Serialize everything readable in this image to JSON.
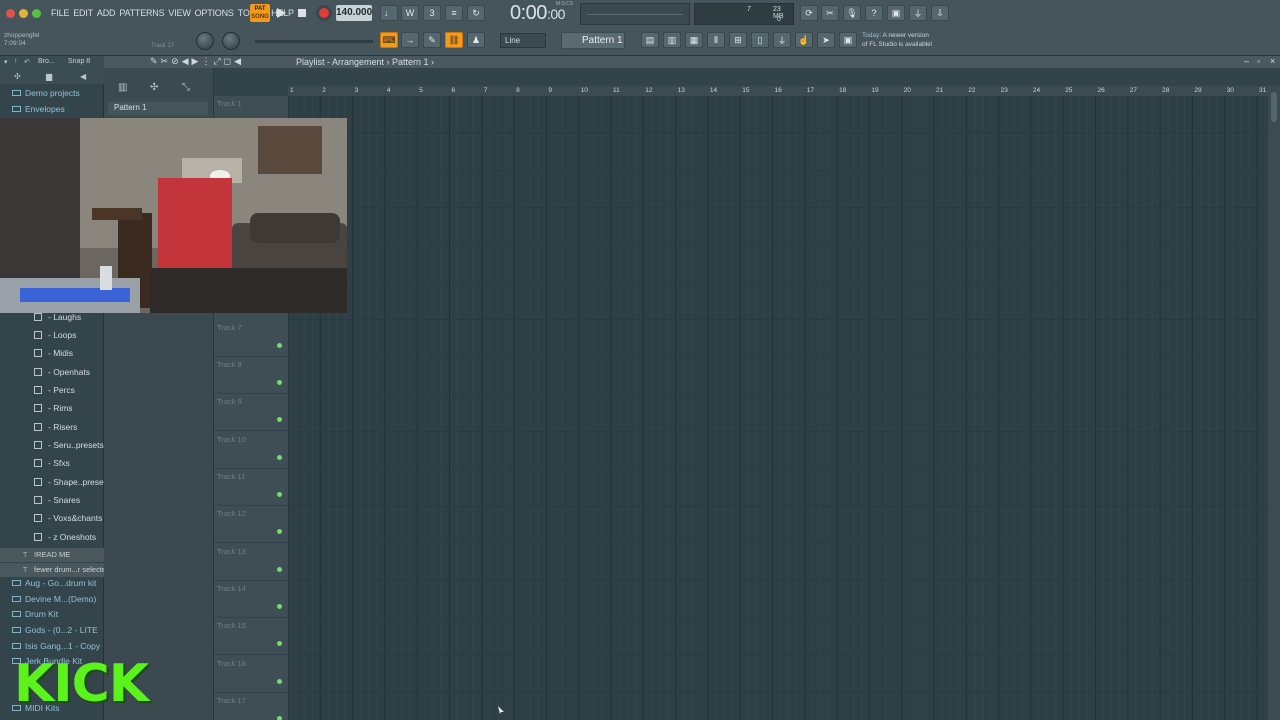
{
  "menu": [
    "FILE",
    "EDIT",
    "ADD",
    "PATTERNS",
    "VIEW",
    "OPTIONS",
    "TOOLS",
    "HELP"
  ],
  "transport": {
    "pat_song_label": "PAT\nSONG",
    "tempo": "140.000",
    "time": "0:00",
    "time_sub": ":00",
    "time_unit": "M:S:CS"
  },
  "cpu": {
    "v1": "7",
    "v2": "23 MB",
    "v3": "0"
  },
  "hint": {
    "line1": "zhoppengfel",
    "line2": "7:09:04",
    "track": "Track 17"
  },
  "toolbar2": {
    "snap_mode": "Line",
    "pattern": "Pattern 1"
  },
  "news": {
    "line1_prefix": "Today:",
    "line1": "A newer version",
    "line2": "of FL Studio is available!"
  },
  "browser": {
    "title": "Bro...",
    "snap": "Snap 8",
    "top_items": [
      "Demo projects",
      "Envelopes"
    ],
    "folders": [
      "- Laughs",
      "- Loops",
      "- Midis",
      "- Openhats",
      "- Percs",
      "- Rims",
      "- Risers",
      "- Seru..presets",
      "- Sfxs",
      "- Shape..presets",
      "- Snares",
      "- Voxs&chants",
      "- z Oneshots"
    ],
    "text_items": [
      "!READ ME",
      "fewer drum...r selected"
    ],
    "bottom_items": [
      "Aug - Go...drum kit",
      "Devine M...(Demo)",
      "Drum Kit",
      "Gods - (0...2 - LITE",
      "Isis Gang...1 - Copy",
      "Jerk Bundle Kit",
      "MIDI Kits"
    ]
  },
  "picker": {
    "pattern_tab": "Pattern 1"
  },
  "playlist": {
    "title": "Playlist - Arrangement › Pattern 1 ›"
  },
  "tracks": [
    "Track 1",
    "Track 7",
    "Track 8",
    "Track 9",
    "Track 10",
    "Track 11",
    "Track 12",
    "Track 13",
    "Track 14",
    "Track 15",
    "Track 16",
    "Track 17"
  ],
  "ruler": [
    "1",
    "2",
    "3",
    "4",
    "5",
    "6",
    "7",
    "8",
    "9",
    "10",
    "11",
    "12",
    "13",
    "14",
    "15",
    "16",
    "17",
    "18",
    "19",
    "20",
    "21",
    "22",
    "23",
    "24",
    "25",
    "26",
    "27",
    "28",
    "29",
    "30",
    "31"
  ],
  "overlay": {
    "kick": "KICK"
  },
  "colors": {
    "accent": "#f39a1d",
    "grid_bg": "#2e3f46",
    "track_led": "#6de06a",
    "kick_green": "#5cf21c"
  }
}
